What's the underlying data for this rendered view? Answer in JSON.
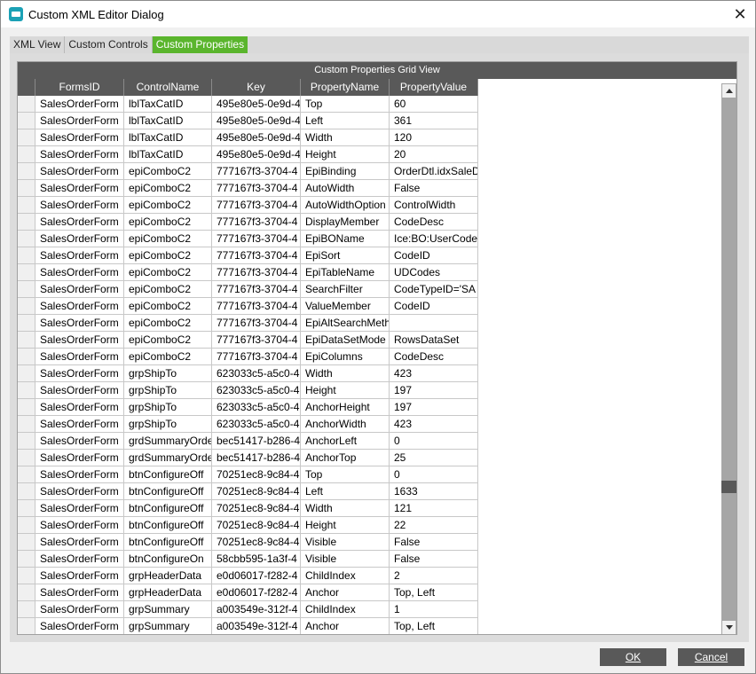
{
  "window": {
    "title": "Custom XML Editor Dialog",
    "close_glyph": "✕"
  },
  "tabs": [
    {
      "label": "XML View",
      "active": false
    },
    {
      "label": "Custom Controls",
      "active": false
    },
    {
      "label": "Custom Properties",
      "active": true
    }
  ],
  "grid": {
    "title": "Custom Properties Grid View",
    "columns": [
      "FormsID",
      "ControlName",
      "Key",
      "PropertyName",
      "PropertyValue"
    ],
    "rows": [
      [
        "SalesOrderForm",
        "lblTaxCatID",
        "495e80e5-0e9d-4",
        "Top",
        "60"
      ],
      [
        "SalesOrderForm",
        "lblTaxCatID",
        "495e80e5-0e9d-4",
        "Left",
        "361"
      ],
      [
        "SalesOrderForm",
        "lblTaxCatID",
        "495e80e5-0e9d-4",
        "Width",
        "120"
      ],
      [
        "SalesOrderForm",
        "lblTaxCatID",
        "495e80e5-0e9d-4",
        "Height",
        "20"
      ],
      [
        "SalesOrderForm",
        "epiComboC2",
        "777167f3-3704-4",
        "EpiBinding",
        "OrderDtl.idxSaleD"
      ],
      [
        "SalesOrderForm",
        "epiComboC2",
        "777167f3-3704-4",
        "AutoWidth",
        "False"
      ],
      [
        "SalesOrderForm",
        "epiComboC2",
        "777167f3-3704-4",
        "AutoWidthOption",
        "ControlWidth"
      ],
      [
        "SalesOrderForm",
        "epiComboC2",
        "777167f3-3704-4",
        "DisplayMember",
        "CodeDesc"
      ],
      [
        "SalesOrderForm",
        "epiComboC2",
        "777167f3-3704-4",
        "EpiBOName",
        "Ice:BO:UserCode"
      ],
      [
        "SalesOrderForm",
        "epiComboC2",
        "777167f3-3704-4",
        "EpiSort",
        "CodeID"
      ],
      [
        "SalesOrderForm",
        "epiComboC2",
        "777167f3-3704-4",
        "EpiTableName",
        "UDCodes"
      ],
      [
        "SalesOrderForm",
        "epiComboC2",
        "777167f3-3704-4",
        "SearchFilter",
        "CodeTypeID='SA"
      ],
      [
        "SalesOrderForm",
        "epiComboC2",
        "777167f3-3704-4",
        "ValueMember",
        "CodeID"
      ],
      [
        "SalesOrderForm",
        "epiComboC2",
        "777167f3-3704-4",
        "EpiAltSearchMeth",
        ""
      ],
      [
        "SalesOrderForm",
        "epiComboC2",
        "777167f3-3704-4",
        "EpiDataSetMode",
        "RowsDataSet"
      ],
      [
        "SalesOrderForm",
        "epiComboC2",
        "777167f3-3704-4",
        "EpiColumns",
        "CodeDesc"
      ],
      [
        "SalesOrderForm",
        "grpShipTo",
        "623033c5-a5c0-4",
        "Width",
        "423"
      ],
      [
        "SalesOrderForm",
        "grpShipTo",
        "623033c5-a5c0-4",
        "Height",
        "197"
      ],
      [
        "SalesOrderForm",
        "grpShipTo",
        "623033c5-a5c0-4",
        "AnchorHeight",
        "197"
      ],
      [
        "SalesOrderForm",
        "grpShipTo",
        "623033c5-a5c0-4",
        "AnchorWidth",
        "423"
      ],
      [
        "SalesOrderForm",
        "grdSummaryOrde",
        "bec51417-b286-4",
        "AnchorLeft",
        "0"
      ],
      [
        "SalesOrderForm",
        "grdSummaryOrde",
        "bec51417-b286-4",
        "AnchorTop",
        "25"
      ],
      [
        "SalesOrderForm",
        "btnConfigureOff",
        "70251ec8-9c84-4",
        "Top",
        "0"
      ],
      [
        "SalesOrderForm",
        "btnConfigureOff",
        "70251ec8-9c84-4",
        "Left",
        "1633"
      ],
      [
        "SalesOrderForm",
        "btnConfigureOff",
        "70251ec8-9c84-4",
        "Width",
        "121"
      ],
      [
        "SalesOrderForm",
        "btnConfigureOff",
        "70251ec8-9c84-4",
        "Height",
        "22"
      ],
      [
        "SalesOrderForm",
        "btnConfigureOff",
        "70251ec8-9c84-4",
        "Visible",
        "False"
      ],
      [
        "SalesOrderForm",
        "btnConfigureOn",
        "58cbb595-1a3f-4",
        "Visible",
        "False"
      ],
      [
        "SalesOrderForm",
        "grpHeaderData",
        "e0d06017-f282-4",
        "ChildIndex",
        "2"
      ],
      [
        "SalesOrderForm",
        "grpHeaderData",
        "e0d06017-f282-4",
        "Anchor",
        "Top, Left"
      ],
      [
        "SalesOrderForm",
        "grpSummary",
        "a003549e-312f-4",
        "ChildIndex",
        "1"
      ],
      [
        "SalesOrderForm",
        "grpSummary",
        "a003549e-312f-4",
        "Anchor",
        "Top, Left"
      ]
    ]
  },
  "buttons": {
    "ok": "OK",
    "cancel": "Cancel"
  },
  "colors": {
    "accent": "#5ab52d",
    "header_bg": "#595959",
    "app_icon": "#1ba1b5"
  }
}
